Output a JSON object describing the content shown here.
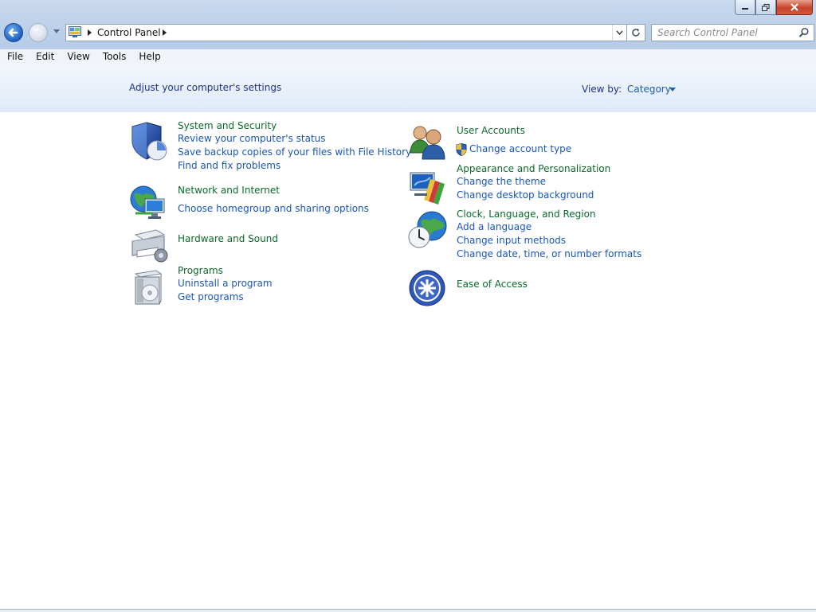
{
  "window": {
    "minimize_icon": "minimize-icon",
    "restore_icon": "restore-icon",
    "close_icon": "close-icon"
  },
  "address_bar": {
    "path": "Control Panel",
    "search_placeholder": "Search Control Panel"
  },
  "menu": [
    "File",
    "Edit",
    "View",
    "Tools",
    "Help"
  ],
  "header": {
    "title": "Adjust your computer's settings",
    "view_by_label": "View by:",
    "view_by_value": "Category"
  },
  "categories": {
    "system_security": {
      "title": "System and Security",
      "links": [
        "Review your computer's status",
        "Save backup copies of your files with File History",
        "Find and fix problems"
      ]
    },
    "network_internet": {
      "title": "Network and Internet",
      "links": [
        "Choose homegroup and sharing options"
      ]
    },
    "hardware_sound": {
      "title": "Hardware and Sound"
    },
    "programs": {
      "title": "Programs",
      "links": [
        "Uninstall a program",
        "Get programs"
      ]
    },
    "user_accounts": {
      "title": "User Accounts",
      "links": [
        "Change account type"
      ]
    },
    "appearance": {
      "title": "Appearance and Personalization",
      "links": [
        "Change the theme",
        "Change desktop background"
      ]
    },
    "clock_region": {
      "title": "Clock, Language, and Region",
      "links": [
        "Add a language",
        "Change input methods",
        "Change date, time, or number formats"
      ]
    },
    "ease_access": {
      "title": "Ease of Access"
    }
  },
  "colors": {
    "category_title": "#0b6a2c",
    "link": "#1a56b8",
    "heading": "#1e3287"
  }
}
